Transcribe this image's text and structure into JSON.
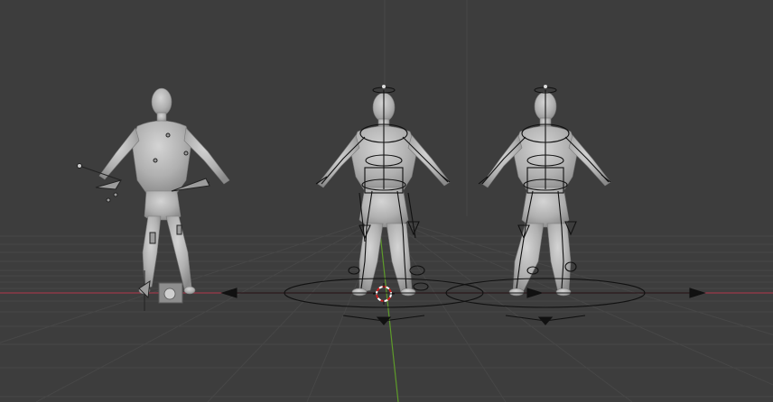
{
  "viewport": {
    "background": "#3d3d3d",
    "grid_color": "#474747",
    "x_axis_color": "#9b3a4a",
    "y_axis_color": "#5e9b2a",
    "mesh_color": "#b8b8b8",
    "rig_line_color": "#111111",
    "cursor_colors": [
      "#d21f1f",
      "#ffffff"
    ]
  },
  "scene_objects": [
    {
      "name": "broken-mannequin",
      "kind": "mesh"
    },
    {
      "name": "rigged-mannequin-center",
      "kind": "mesh-with-armature"
    },
    {
      "name": "rigged-mannequin-right",
      "kind": "mesh-with-armature"
    }
  ],
  "icons": {
    "cursor": "3d-cursor-icon",
    "empty_cube": "empty-object-icon"
  }
}
